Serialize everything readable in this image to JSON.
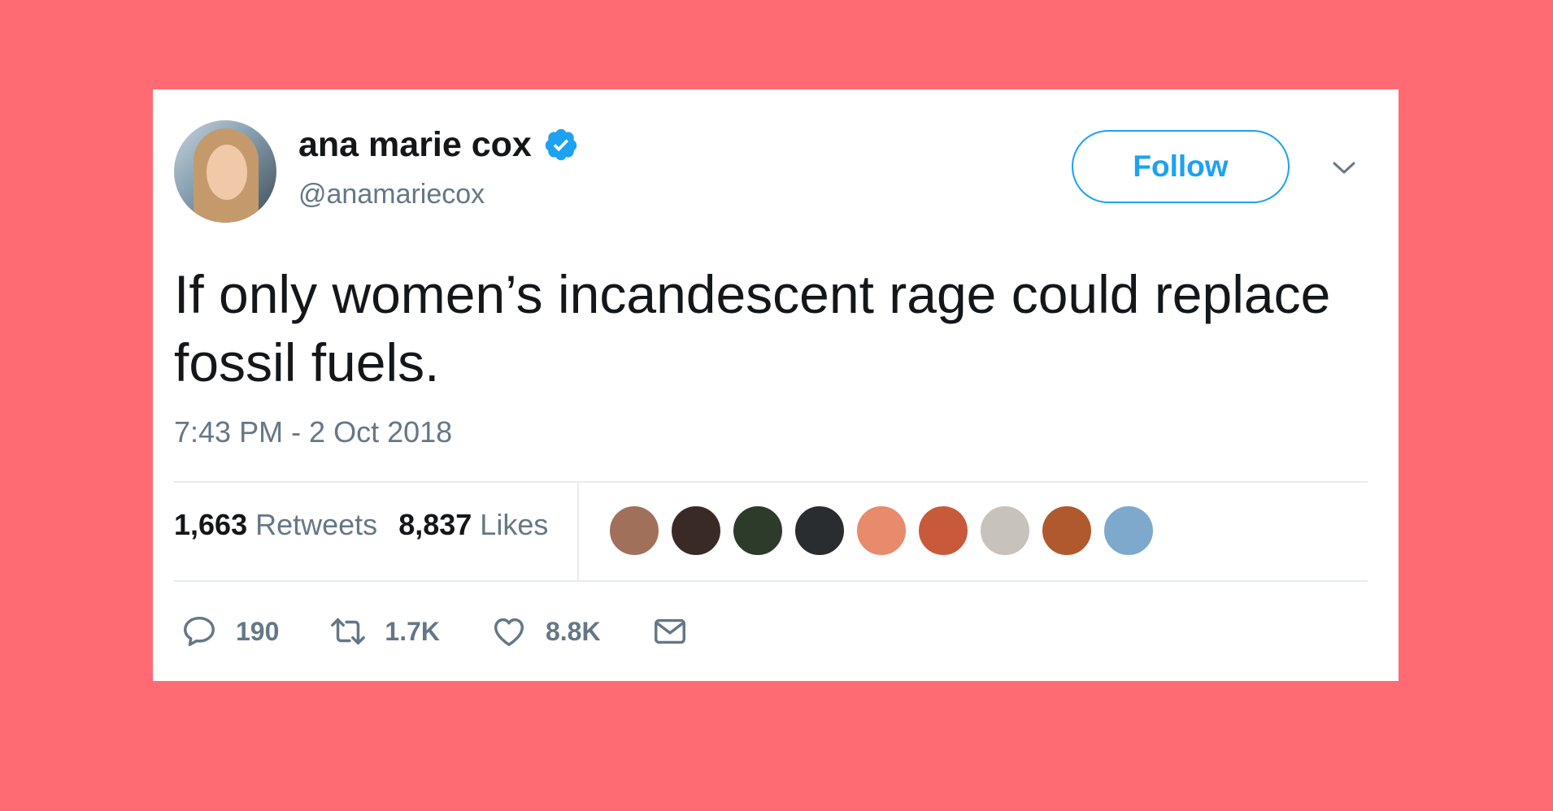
{
  "colors": {
    "background": "#ff6b73",
    "card": "#ffffff",
    "accent": "#1da1f2",
    "text_primary": "#14171a",
    "text_secondary": "#657786",
    "divider": "#e6ecf0"
  },
  "author": {
    "display_name": "ana marie cox",
    "handle": "@anamariecox",
    "verified_icon": "verified-badge-icon",
    "avatar": "author-avatar"
  },
  "header": {
    "follow_label": "Follow",
    "menu_icon": "chevron-down-icon"
  },
  "tweet": {
    "text": "If only women’s incandescent rage could replace fossil fuels.",
    "timestamp": "7:43 PM - 2 Oct 2018"
  },
  "stats": {
    "retweets_count": "1,663",
    "retweets_label": "Retweets",
    "likes_count": "8,837",
    "likes_label": "Likes"
  },
  "likers": [
    {
      "color": "#a0705a"
    },
    {
      "color": "#3a2a26"
    },
    {
      "color": "#2c3b2a"
    },
    {
      "color": "#2a2d30"
    },
    {
      "color": "#e88a6c"
    },
    {
      "color": "#c8593a"
    },
    {
      "color": "#c7c2bc"
    },
    {
      "color": "#b0582e"
    },
    {
      "color": "#7ea8cc"
    }
  ],
  "actions": {
    "reply_icon": "reply-icon",
    "reply_count": "190",
    "retweet_icon": "retweet-icon",
    "retweet_count": "1.7K",
    "like_icon": "heart-icon",
    "like_count": "8.8K",
    "dm_icon": "envelope-icon"
  }
}
